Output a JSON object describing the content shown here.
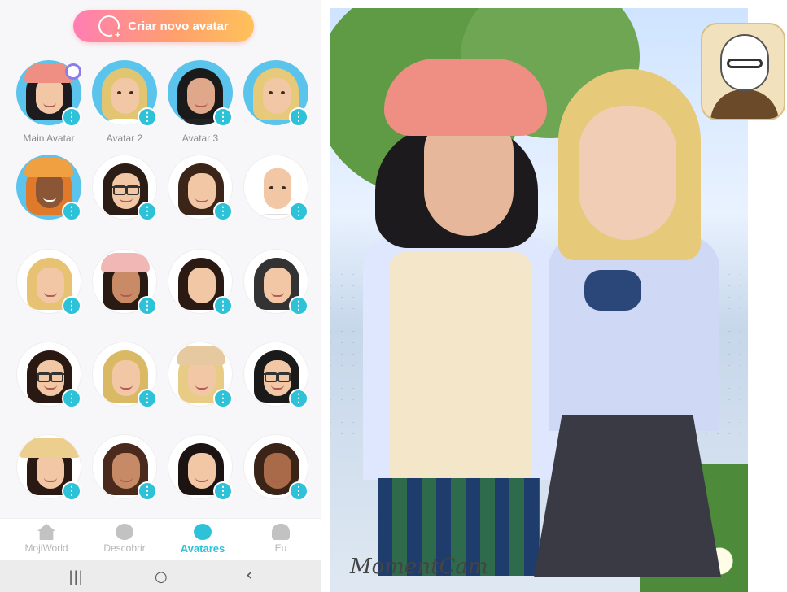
{
  "phone": {
    "create_button_label": "Criar novo avatar",
    "avatars": [
      {
        "caption": "Main Avatar",
        "selected": true
      },
      {
        "caption": "Avatar 2"
      },
      {
        "caption": "Avatar 3"
      },
      {
        "caption": ""
      }
    ],
    "nav": [
      {
        "label": "MojiWorld",
        "icon": "home-icon"
      },
      {
        "label": "Descobrir",
        "icon": "compass-icon"
      },
      {
        "label": "Avatares",
        "icon": "smiley-icon",
        "active": true
      },
      {
        "label": "Eu",
        "icon": "person-icon"
      }
    ],
    "system_nav": {
      "recents": "|||",
      "home": "○",
      "back": "‹"
    }
  },
  "illustration": {
    "signature": "MomentCam"
  },
  "colors": {
    "accent": "#2ec2d8",
    "create_gradient_start": "#ff7eb3",
    "create_gradient_end": "#ffc15a",
    "avatar_ring": "#5bc4ec"
  }
}
